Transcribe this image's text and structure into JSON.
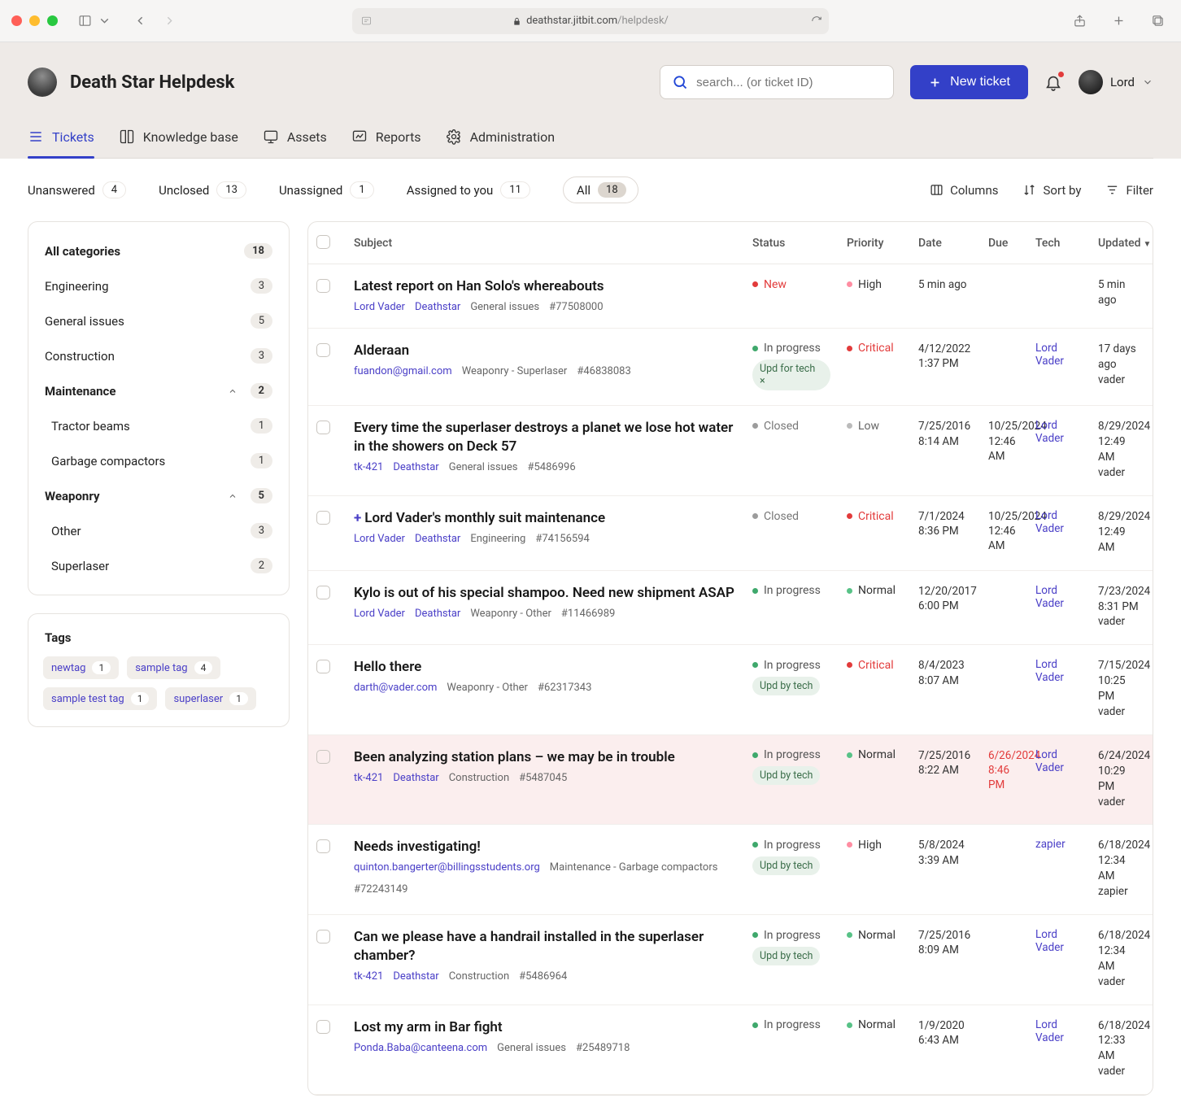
{
  "browser": {
    "url_host": "deathstar.jitbit.com",
    "url_path": "/helpdesk/"
  },
  "app": {
    "title": "Death Star Helpdesk",
    "search_placeholder": "search... (or ticket ID)",
    "new_ticket_label": "New ticket",
    "user_name": "Lord"
  },
  "nav": {
    "tickets": "Tickets",
    "kb": "Knowledge base",
    "assets": "Assets",
    "reports": "Reports",
    "admin": "Administration"
  },
  "filters": {
    "unanswered": {
      "label": "Unanswered",
      "count": "4"
    },
    "unclosed": {
      "label": "Unclosed",
      "count": "13"
    },
    "unassigned": {
      "label": "Unassigned",
      "count": "1"
    },
    "assigned_to_you": {
      "label": "Assigned to you",
      "count": "11"
    },
    "all": {
      "label": "All",
      "count": "18"
    },
    "columns": "Columns",
    "sort_by": "Sort by",
    "filter": "Filter"
  },
  "categories": {
    "all": {
      "label": "All categories",
      "count": "18"
    },
    "engineering": {
      "label": "Engineering",
      "count": "3"
    },
    "general": {
      "label": "General issues",
      "count": "5"
    },
    "construction": {
      "label": "Construction",
      "count": "3"
    },
    "maintenance": {
      "label": "Maintenance",
      "count": "2"
    },
    "tractor_beams": {
      "label": "Tractor beams",
      "count": "1"
    },
    "garbage": {
      "label": "Garbage compactors",
      "count": "1"
    },
    "weaponry": {
      "label": "Weaponry",
      "count": "5"
    },
    "other": {
      "label": "Other",
      "count": "3"
    },
    "superlaser": {
      "label": "Superlaser",
      "count": "2"
    }
  },
  "tags": {
    "title": "Tags",
    "items": [
      {
        "label": "newtag",
        "count": "1"
      },
      {
        "label": "sample tag",
        "count": "4"
      },
      {
        "label": "sample test tag",
        "count": "1"
      },
      {
        "label": "superlaser",
        "count": "1"
      }
    ]
  },
  "columns": {
    "subject": "Subject",
    "status": "Status",
    "priority": "Priority",
    "date": "Date",
    "due": "Due",
    "tech": "Tech",
    "updated": "Updated"
  },
  "status_labels": {
    "new": "New",
    "closed": "Closed",
    "in_progress": "In progress",
    "upd_for_tech": "Upd for tech",
    "upd_by_tech": "Upd by tech"
  },
  "priority_labels": {
    "high": "High",
    "critical": "Critical",
    "low": "Low",
    "normal": "Normal"
  },
  "tickets": [
    {
      "title": "Latest report on Han Solo's whereabouts",
      "requester": "Lord Vader",
      "company": "Deathstar",
      "category": "General issues",
      "ticket": "#77508000",
      "status": "new",
      "sub_status": "",
      "priority": "high",
      "date_l1": "5 min ago",
      "date_l2": "",
      "due_l1": "",
      "due_l2": "",
      "tech": "",
      "updated_l1": "5 min ago",
      "updated_l2": "",
      "updated_by": "",
      "has_plus": false,
      "overdue": false
    },
    {
      "title": "Alderaan",
      "requester": "fuandon@gmail.com",
      "company": "",
      "category": "Weaponry - Superlaser",
      "ticket": "#46838083",
      "status": "in_progress",
      "sub_status": "upd_for_tech",
      "priority": "critical",
      "date_l1": "4/12/2022",
      "date_l2": "1:37 PM",
      "due_l1": "",
      "due_l2": "",
      "tech": "Lord Vader",
      "updated_l1": "17 days ago",
      "updated_l2": "",
      "updated_by": "vader",
      "has_plus": false,
      "overdue": false
    },
    {
      "title": "Every time the superlaser destroys a planet we lose hot water in the showers on Deck 57",
      "requester": "tk-421",
      "company": "Deathstar",
      "category": "General issues",
      "ticket": "#5486996",
      "status": "closed",
      "sub_status": "",
      "priority": "low",
      "date_l1": "7/25/2016",
      "date_l2": "8:14 AM",
      "due_l1": "10/25/2024",
      "due_l2": "12:46 AM",
      "tech": "Lord Vader",
      "updated_l1": "8/29/2024",
      "updated_l2": "12:49 AM",
      "updated_by": "vader",
      "has_plus": false,
      "overdue": false
    },
    {
      "title": "Lord Vader's monthly suit maintenance",
      "requester": "Lord Vader",
      "company": "Deathstar",
      "category": "Engineering",
      "ticket": "#74156594",
      "status": "closed",
      "sub_status": "",
      "priority": "critical",
      "date_l1": "7/1/2024",
      "date_l2": "8:36 PM",
      "due_l1": "10/25/2024",
      "due_l2": "12:46 AM",
      "tech": "Lord Vader",
      "updated_l1": "8/29/2024",
      "updated_l2": "12:49 AM",
      "updated_by": "",
      "has_plus": true,
      "overdue": false
    },
    {
      "title": "Kylo is out of his special shampoo. Need new shipment ASAP",
      "requester": "Lord Vader",
      "company": "Deathstar",
      "category": "Weaponry - Other",
      "ticket": "#11466989",
      "status": "in_progress",
      "sub_status": "",
      "priority": "normal",
      "date_l1": "12/20/2017",
      "date_l2": "6:00 PM",
      "due_l1": "",
      "due_l2": "",
      "tech": "Lord Vader",
      "updated_l1": "7/23/2024",
      "updated_l2": "8:31 PM",
      "updated_by": "vader",
      "has_plus": false,
      "overdue": false
    },
    {
      "title": "Hello there",
      "requester": "darth@vader.com",
      "company": "",
      "category": "Weaponry - Other",
      "ticket": "#62317343",
      "status": "in_progress",
      "sub_status": "upd_by_tech",
      "priority": "critical",
      "date_l1": "8/4/2023",
      "date_l2": "8:07 AM",
      "due_l1": "",
      "due_l2": "",
      "tech": "Lord Vader",
      "updated_l1": "7/15/2024",
      "updated_l2": "10:25 PM",
      "updated_by": "vader",
      "has_plus": false,
      "overdue": false
    },
    {
      "title": "Been analyzing station plans – we may be in trouble",
      "requester": "tk-421",
      "company": "Deathstar",
      "category": "Construction",
      "ticket": "#5487045",
      "status": "in_progress",
      "sub_status": "upd_by_tech",
      "priority": "normal",
      "date_l1": "7/25/2016",
      "date_l2": "8:22 AM",
      "due_l1": "6/26/2024",
      "due_l2": "8:46 PM",
      "tech": "Lord Vader",
      "updated_l1": "6/24/2024",
      "updated_l2": "10:29 PM",
      "updated_by": "vader",
      "has_plus": false,
      "overdue": true
    },
    {
      "title": "Needs investigating!",
      "requester": "quinton.bangerter@billingsstudents.org",
      "company": "",
      "category": "Maintenance - Garbage compactors",
      "ticket": "#72243149",
      "status": "in_progress",
      "sub_status": "upd_by_tech",
      "priority": "high",
      "date_l1": "5/8/2024",
      "date_l2": "3:39 AM",
      "due_l1": "",
      "due_l2": "",
      "tech": "zapier",
      "updated_l1": "6/18/2024",
      "updated_l2": "12:34 AM",
      "updated_by": "zapier",
      "has_plus": false,
      "overdue": false
    },
    {
      "title": "Can we please have a handrail installed in the superlaser chamber?",
      "requester": "tk-421",
      "company": "Deathstar",
      "category": "Construction",
      "ticket": "#5486964",
      "status": "in_progress",
      "sub_status": "upd_by_tech",
      "priority": "normal",
      "date_l1": "7/25/2016",
      "date_l2": "8:09 AM",
      "due_l1": "",
      "due_l2": "",
      "tech": "Lord Vader",
      "updated_l1": "6/18/2024",
      "updated_l2": "12:34 AM",
      "updated_by": "vader",
      "has_plus": false,
      "overdue": false
    },
    {
      "title": "Lost my arm in Bar fight",
      "requester": "Ponda.Baba@canteena.com",
      "company": "",
      "category": "General issues",
      "ticket": "#25489718",
      "status": "in_progress",
      "sub_status": "",
      "priority": "normal",
      "date_l1": "1/9/2020",
      "date_l2": "6:43 AM",
      "due_l1": "",
      "due_l2": "",
      "tech": "Lord Vader",
      "updated_l1": "6/18/2024",
      "updated_l2": "12:33 AM",
      "updated_by": "vader",
      "has_plus": false,
      "overdue": false
    }
  ]
}
